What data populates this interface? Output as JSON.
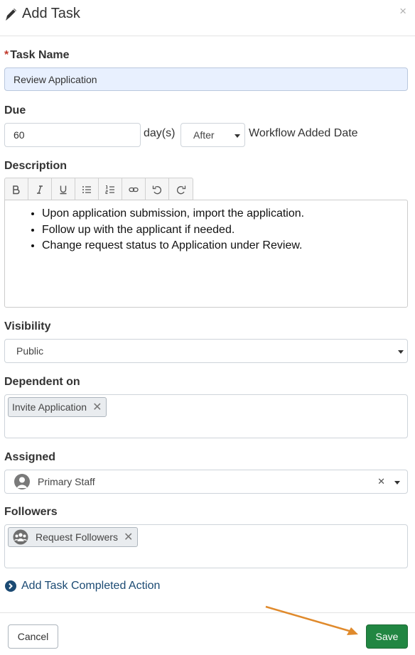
{
  "modal": {
    "title": "Add Task",
    "close_glyph": "×"
  },
  "task_name": {
    "label": "Task Name",
    "required_mark": "*",
    "value": "Review Application"
  },
  "due": {
    "label": "Due",
    "value": "60",
    "unit_label": "day(s)",
    "relation_selected": "After",
    "anchor_label": "Workflow Added Date"
  },
  "description": {
    "label": "Description",
    "toolbar": [
      "bold-icon",
      "italic-icon",
      "underline-icon",
      "bullet-list-icon",
      "numbered-list-icon",
      "link-icon",
      "undo-icon",
      "redo-icon"
    ],
    "items": [
      "Upon application submission, import the application.",
      "Follow up with the applicant if needed.",
      "Change request status to Application under Review."
    ]
  },
  "visibility": {
    "label": "Visibility",
    "selected": "Public"
  },
  "dependent_on": {
    "label": "Dependent on",
    "tags": [
      "Invite Application"
    ],
    "remove_glyph": "✕"
  },
  "assigned": {
    "label": "Assigned",
    "value": "Primary Staff",
    "clear_glyph": "✕"
  },
  "followers": {
    "label": "Followers",
    "tags": [
      "Request Followers"
    ],
    "remove_glyph": "✕"
  },
  "completed_action": {
    "label": "Add Task Completed Action"
  },
  "footer": {
    "cancel_label": "Cancel",
    "save_label": "Save"
  },
  "colors": {
    "save": "#218642",
    "link": "#1b4a73",
    "arrow": "#e08a2c",
    "required": "#c0392b",
    "highlight": "#e8f0fe"
  }
}
